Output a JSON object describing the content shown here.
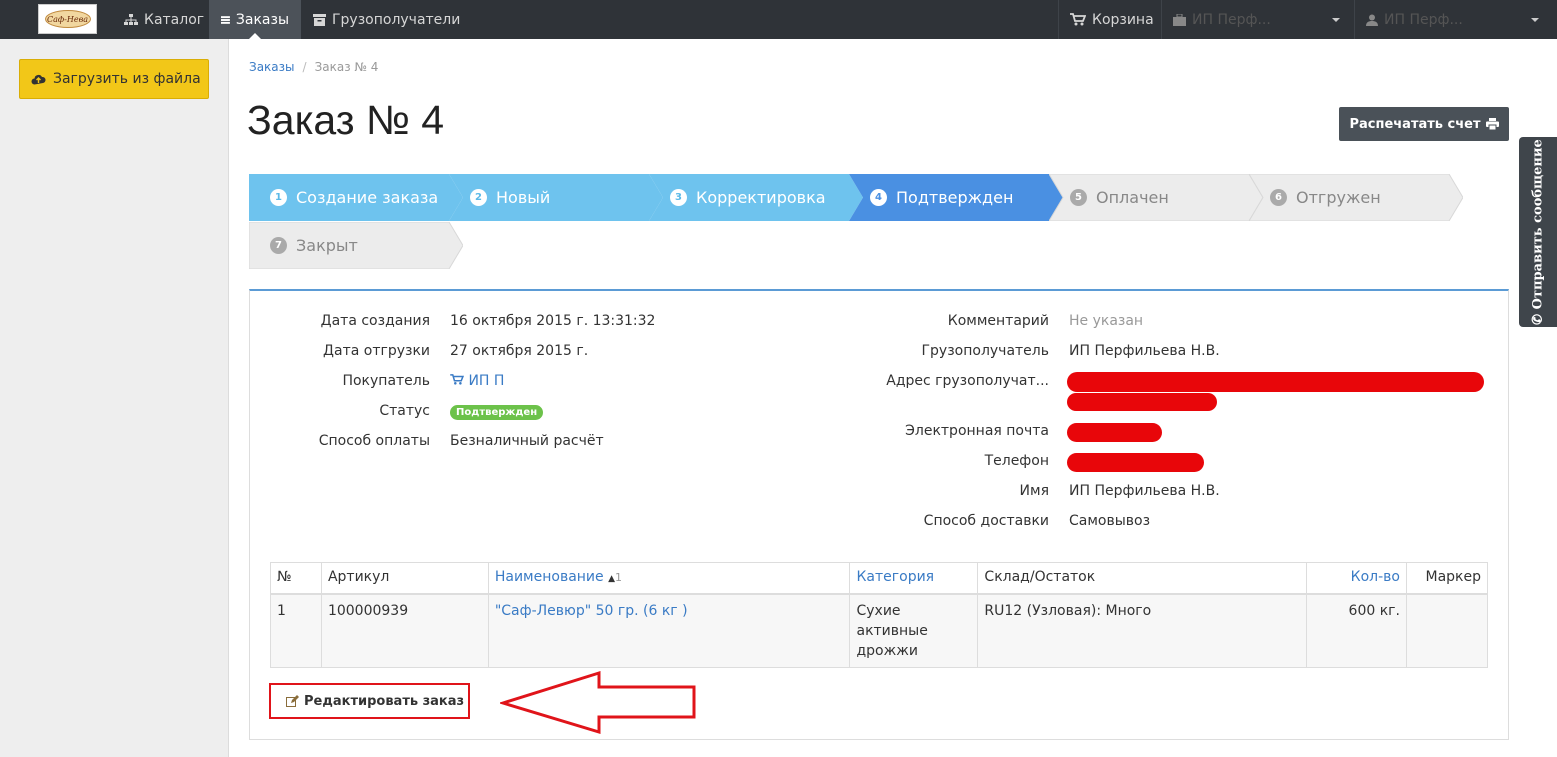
{
  "navbar": {
    "logo_text": "Саф-Нева",
    "catalog": "Каталог",
    "orders": "Заказы",
    "consignees": "Грузополучатели",
    "cart": "Корзина",
    "company_menu": "ИП Перф...",
    "user_menu": "ИП Перф..."
  },
  "sidebar": {
    "upload_button": "Загрузить из файла"
  },
  "breadcrumb": {
    "root": "Заказы",
    "current": "Заказ № 4"
  },
  "header": {
    "title": "Заказ № 4",
    "print_button": "Распечатать счет"
  },
  "steps": [
    {
      "num": "1",
      "label": "Создание заказа"
    },
    {
      "num": "2",
      "label": "Новый"
    },
    {
      "num": "3",
      "label": "Корректировка"
    },
    {
      "num": "4",
      "label": "Подтвержден"
    },
    {
      "num": "5",
      "label": "Оплачен"
    },
    {
      "num": "6",
      "label": "Отгружен"
    },
    {
      "num": "7",
      "label": "Закрыт"
    }
  ],
  "feedback_tab": "Отправить сообщение",
  "details_left": {
    "created_label": "Дата создания",
    "created_value": "16 октября 2015 г. 13:31:32",
    "shipping_label": "Дата отгрузки",
    "shipping_value": "27 октября 2015 г.",
    "buyer_label": "Покупатель",
    "buyer_value": "ИП П",
    "status_label": "Статус",
    "status_value": "Подтвержден",
    "payment_label": "Способ оплаты",
    "payment_value": "Безналичный расчёт"
  },
  "details_right": {
    "comment_label": "Комментарий",
    "comment_value": "Не указан",
    "consignee_label": "Грузополучатель",
    "consignee_value": "ИП Перфильева Н.В.",
    "address_label": "Адрес грузополучат...",
    "email_label": "Электронная почта",
    "phone_label": "Телефон",
    "name_label": "Имя",
    "name_value": "ИП Перфильева Н.В.",
    "delivery_label": "Способ доставки",
    "delivery_value": "Самовывоз"
  },
  "table": {
    "headers": {
      "num": "№",
      "sku": "Артикул",
      "name": "Наименование",
      "name_sort_index": "1",
      "category": "Категория",
      "stock": "Склад/Остаток",
      "qty": "Кол-во",
      "marker": "Маркер"
    },
    "rows": [
      {
        "num": "1",
        "sku": "100000939",
        "name": "\"Саф-Левюр\" 50 гр. (6 кг )",
        "category": "Сухие активные дрожжи",
        "stock": "RU12 (Узловая): Много",
        "qty": "600 кг.",
        "marker": ""
      }
    ]
  },
  "edit_button": "Редактировать заказ",
  "colors": {
    "navbar": "#2f3338",
    "step_done": "#6ec3ee",
    "step_current": "#4a90e2",
    "step_todo": "#ececec",
    "upload_button": "#f2c718",
    "highlight": "#e0141a"
  }
}
